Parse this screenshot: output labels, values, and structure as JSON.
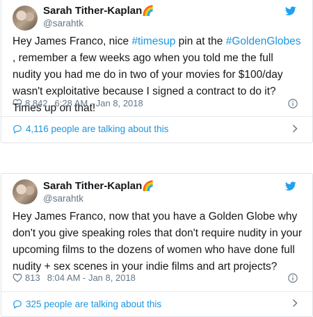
{
  "tweets": [
    {
      "display_name": "Sarah Tither-Kaplan",
      "emoji": "🌈",
      "handle": "@sarahtk",
      "text_parts": {
        "p1": "Hey James Franco, nice ",
        "tag1": "#timesup",
        "p2": "  pin at the ",
        "tag2": "#GoldenGlobes",
        "p3": " , remember a few weeks ago when you told me the full nudity you had me do in two of your movies for $100/day wasn't exploitative because I signed a contract to do it? Times up on that!"
      },
      "likes": "8,842",
      "timestamp": "6:28 AM - Jan 8, 2018",
      "talking": "4,116 people are talking about this"
    },
    {
      "display_name": "Sarah Tither-Kaplan",
      "emoji": "🌈",
      "handle": "@sarahtk",
      "text": "Hey James Franco, now that you have a Golden Globe why don't you give speaking roles that don't require nudity in your upcoming films to the dozens of women who have done full nudity + sex scenes in your indie films and art projects?",
      "likes": "813",
      "timestamp": "8:04 AM - Jan 8, 2018",
      "talking": "325 people are talking about this"
    }
  ],
  "colors": {
    "link": "#1b95e0",
    "secondary_text": "#657786",
    "border": "#dfe3e6"
  },
  "icons": [
    "twitter-bird-icon",
    "heart-icon",
    "info-icon",
    "reply-bubble-icon",
    "chevron-right-icon"
  ]
}
